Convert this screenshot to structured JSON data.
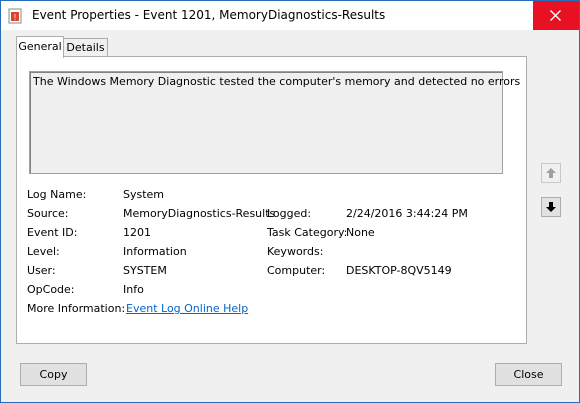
{
  "window": {
    "title": "Event Properties - Event 1201, MemoryDiagnostics-Results",
    "close_glyph": "close-icon"
  },
  "tabs": [
    {
      "label": "General",
      "selected": true
    },
    {
      "label": "Details",
      "selected": false
    }
  ],
  "general": {
    "description": "The Windows Memory Diagnostic tested the computer's memory and detected no errors",
    "fields": {
      "log_name": {
        "label": "Log Name:",
        "value": "System"
      },
      "source": {
        "label": "Source:",
        "value": "MemoryDiagnostics-Results"
      },
      "logged": {
        "label": "Logged:",
        "value": "2/24/2016 3:44:24 PM"
      },
      "event_id": {
        "label": "Event ID:",
        "value": "1201"
      },
      "task_category": {
        "label": "Task Category:",
        "value": "None"
      },
      "level": {
        "label": "Level:",
        "value": "Information"
      },
      "keywords": {
        "label": "Keywords:",
        "value": ""
      },
      "user": {
        "label": "User:",
        "value": "SYSTEM"
      },
      "computer": {
        "label": "Computer:",
        "value": "DESKTOP-8QV5149"
      },
      "opcode": {
        "label": "OpCode:",
        "value": "Info"
      },
      "more_info": {
        "label": "More Information:",
        "value": "Event Log Online Help"
      }
    }
  },
  "buttons": {
    "copy": "Copy",
    "close": "Close"
  },
  "colors": {
    "accent_border": "#2b6cb9",
    "close_button": "#e81123",
    "link": "#0066cc"
  }
}
